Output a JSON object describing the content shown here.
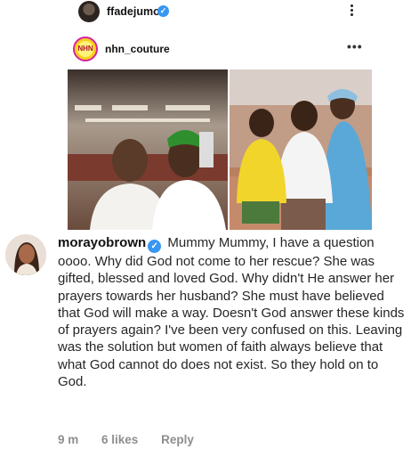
{
  "topbar": {
    "username": "ffadejumo",
    "verified": "✓"
  },
  "post": {
    "username": "nhn_couture",
    "avatar_text": "NHN",
    "more": "•••"
  },
  "comment": {
    "username": "morayobrown",
    "verified": "✓",
    "text": "Mummy Mummy, I have a question oooo. Why did God not come to her rescue? She was gifted, blessed and loved God. Why didn't He answer her prayers towards her husband? She must have believed that God will make a way. Doesn't God answer these kinds of prayers again? I've been very confused on this. Leaving was the solution but women of faith always believe that what God cannot do does not exist. So they hold on to God.",
    "time": "9 m",
    "likes": "6 likes",
    "reply": "Reply"
  },
  "colors": {
    "verified_blue": "#3897f0",
    "meta_gray": "#8e8e8e"
  }
}
